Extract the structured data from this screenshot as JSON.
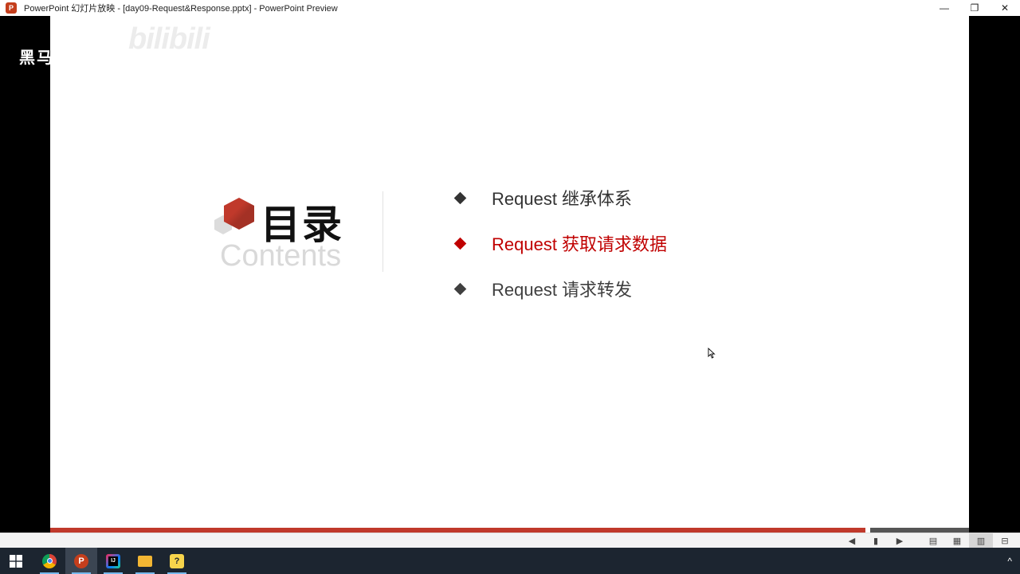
{
  "window": {
    "title": "PowerPoint 幻灯片放映 - [day09-Request&Response.pptx] - PowerPoint Preview",
    "app_icon": "powerpoint-icon",
    "minimize": "—",
    "restore": "❐",
    "close": "✕"
  },
  "watermarks": {
    "left": "黑马",
    "bilibili": "bilibili"
  },
  "slide": {
    "title": "目录",
    "subtitle": "Contents",
    "items": [
      {
        "label": "Request 继承体系",
        "color": "#333333"
      },
      {
        "label": "Request 获取请求数据",
        "color": "#c00000"
      },
      {
        "label": "Request 请求转发",
        "color": "#404040"
      }
    ]
  },
  "progress": {
    "fraction": 0.887
  },
  "status_buttons": [
    {
      "name": "previous-icon",
      "glyph": "◀"
    },
    {
      "name": "pause-icon",
      "glyph": "▮"
    },
    {
      "name": "next-icon",
      "glyph": "▶"
    },
    {
      "name": "normal-view-icon",
      "glyph": "▤"
    },
    {
      "name": "slide-sorter-icon",
      "glyph": "▦"
    },
    {
      "name": "reading-view-icon",
      "glyph": "▥"
    },
    {
      "name": "slideshow-icon",
      "glyph": "⊟"
    }
  ],
  "taskbar": {
    "apps": [
      {
        "name": "chrome-icon",
        "label": "",
        "color": "#e0a020"
      },
      {
        "name": "powerpoint-icon",
        "label": "P",
        "color": "#c43e1c"
      },
      {
        "name": "intellij-icon",
        "label": "IJ",
        "color": "#1a73c8"
      },
      {
        "name": "file-explorer-icon",
        "label": "",
        "color": "#f2b633"
      },
      {
        "name": "python-icon",
        "label": "?",
        "color": "#f7d44b"
      }
    ],
    "tray_chevron": "^"
  },
  "colors": {
    "accent": "#c0392b",
    "active_item": "#c00000"
  }
}
